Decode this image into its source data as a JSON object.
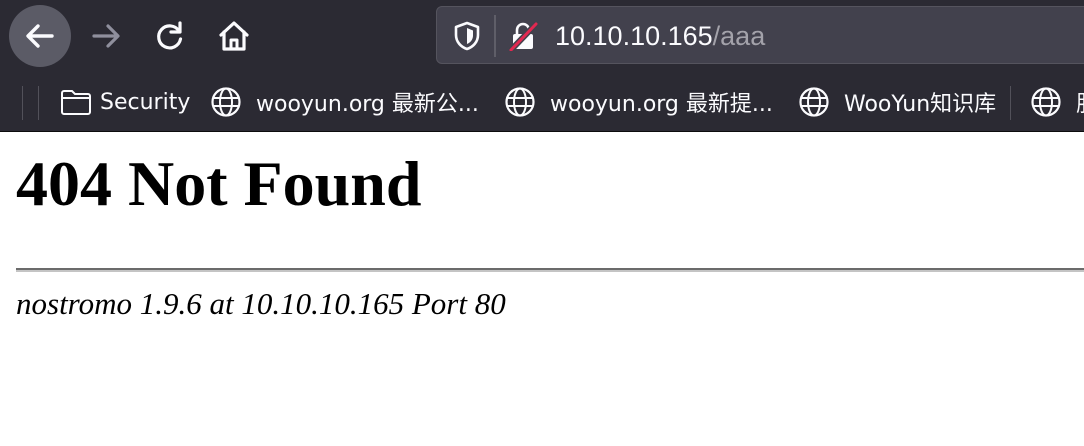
{
  "toolbar": {
    "back_icon": "arrow-left-icon",
    "forward_icon": "arrow-right-icon",
    "reload_icon": "reload-icon",
    "home_icon": "home-icon",
    "url_host": "10.10.10.165",
    "url_path": "/aaa",
    "shield_icon": "tracking-protection-shield-icon",
    "lock_icon": "insecure-lock-icon"
  },
  "bookmarks": {
    "items": [
      {
        "label": "Security",
        "icon": "folder-icon"
      },
      {
        "label": "wooyun.org 最新公...",
        "icon": "globe-icon"
      },
      {
        "label": "wooyun.org 最新提...",
        "icon": "globe-icon"
      },
      {
        "label": "WooYun知识库",
        "icon": "globe-icon"
      },
      {
        "label": "服",
        "icon": "globe-icon"
      }
    ]
  },
  "page": {
    "title": "404 Not Found",
    "server_signature": "nostromo 1.9.6 at 10.10.10.165 Port 80"
  },
  "colors": {
    "chrome_bg": "#2b2a33",
    "urlbar_bg": "#42414d",
    "insecure_red": "#e22850",
    "text_light": "#fbfbfe",
    "text_dim": "#a3a2aa"
  }
}
